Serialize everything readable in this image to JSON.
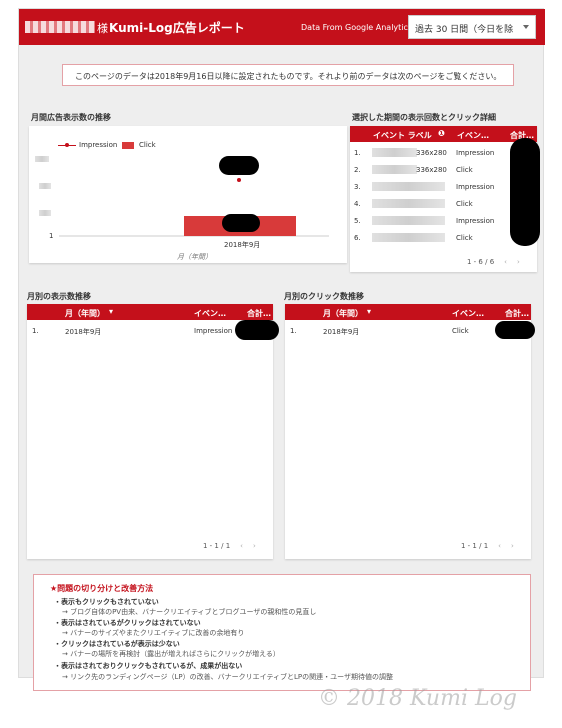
{
  "header": {
    "name_suffix": "様",
    "title": "Kumi-Log広告レポート",
    "source": "Data From Google Analytics",
    "date_range": "過去 30 日間（今日を除",
    "colors": {
      "accent": "#c4101b"
    }
  },
  "notice": "このページのデータは2018年9月16日以降に設定されたものです。それより前のデータは次のページをご覧ください。",
  "monthly_chart": {
    "section_title": "月間広告表示数の推移",
    "legend": [
      "Impression",
      "Click"
    ],
    "y_tick": "1",
    "x_label": "2018年9月",
    "x_axis_title": "月（年間）"
  },
  "chart_data": {
    "type": "bar",
    "categories": [
      "2018年9月"
    ],
    "series": [
      {
        "name": "Impression",
        "kind": "line"
      },
      {
        "name": "Click",
        "kind": "bar"
      }
    ],
    "xlabel": "月（年間）",
    "ylabel": ""
  },
  "detail_table": {
    "section_title": "選択した期間の表示回数とクリック詳細",
    "columns": [
      "イベント ラベル",
      "イベン…",
      "合計…"
    ],
    "rows": [
      {
        "num": "1.",
        "size": "336x280",
        "event": "Impression"
      },
      {
        "num": "2.",
        "size": "336x280",
        "event": "Click"
      },
      {
        "num": "3.",
        "size": "",
        "event": "Impression"
      },
      {
        "num": "4.",
        "size": "",
        "event": "Click"
      },
      {
        "num": "5.",
        "size": "",
        "event": "Impression"
      },
      {
        "num": "6.",
        "size": "",
        "event": "Click"
      }
    ],
    "pager": "1 - 6 / 6"
  },
  "imp_table": {
    "section_title": "月別の表示数推移",
    "columns": [
      "月（年間）",
      "イベン…",
      "合計…"
    ],
    "rows": [
      {
        "num": "1.",
        "month": "2018年9月",
        "event": "Impression"
      }
    ],
    "pager": "1 - 1 / 1"
  },
  "click_table": {
    "section_title": "月別のクリック数推移",
    "columns": [
      "月（年間）",
      "イベン…",
      "合計…"
    ],
    "rows": [
      {
        "num": "1.",
        "month": "2018年9月",
        "event": "Click"
      }
    ],
    "pager": "1 - 1 / 1"
  },
  "problems": {
    "title": "★問題の切り分けと改善方法",
    "items": [
      {
        "head": "・表示もクリックもされていない",
        "desc": "→ ブログ自体のPV由来、バナークリエイティブとブログユーザの親和性の見直し"
      },
      {
        "head": "・表示はされているがクリックはされていない",
        "desc": "→ バナーのサイズやまたクリエイティブに改善の余地有り"
      },
      {
        "head": "・クリックはされているが表示は少ない",
        "desc": "→ バナーの場所を再検討（露出が増えればさらにクリックが増える）"
      },
      {
        "head": "・表示はされておりクリックもされているが、成果が出ない",
        "desc": "→ リンク先のランディングページ（LP）の改善、バナークリエイティブとLPの関連・ユーザ期待値の調整"
      }
    ]
  },
  "watermark": "© 2018 Kumi Log"
}
